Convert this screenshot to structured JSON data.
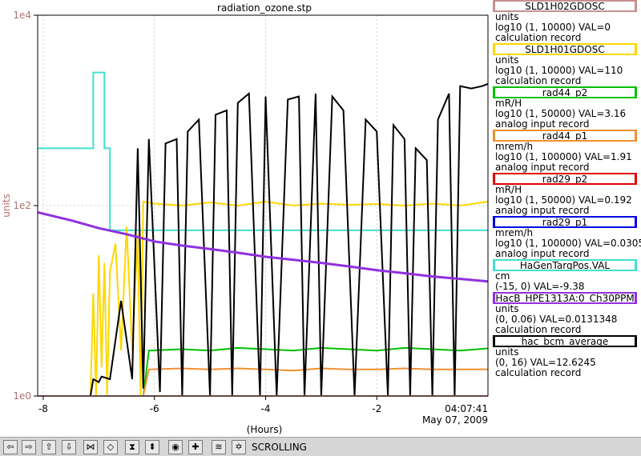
{
  "chart_data": {
    "type": "line",
    "title": "radiation_ozone.stp",
    "xlabel": "(Hours)",
    "ylabel": "units",
    "xlim": [
      -8.1,
      0
    ],
    "ylim": [
      1,
      10000
    ],
    "yscale": "log",
    "x_ticks": [
      "-8",
      "-6",
      "-4",
      "-2"
    ],
    "y_ticks": [
      "1e0",
      "1e2",
      "1e4"
    ],
    "end_time": "04:07:41",
    "end_date": "May 07, 2009",
    "grid": true,
    "series": [
      {
        "name": "SLD1H02GDOSC",
        "units": "units",
        "range": "log10 (1, 10000)  VAL=0",
        "record": "calculation record",
        "color": "#c89090",
        "x": [
          -8.1,
          0
        ],
        "y": [
          1,
          1
        ]
      },
      {
        "name": "SLD1H01GDOSC",
        "units": "units",
        "range": "log10 (1, 10000) VAL=110",
        "record": "calculation record",
        "color": "#ffd700",
        "x": [
          -8.1,
          -7.15,
          -7.1,
          -7.05,
          -7.0,
          -6.95,
          -6.9,
          -6.85,
          -6.8,
          -6.7,
          -6.6,
          -6.5,
          -6.4,
          -6.3,
          -6.25,
          -6.2,
          -6.0,
          -5.5,
          -5.0,
          -4.5,
          -4.0,
          -3.5,
          -3.0,
          -2.5,
          -2.0,
          -1.5,
          -1.0,
          -0.5,
          0
        ],
        "y": [
          1,
          1,
          12,
          1,
          30,
          2,
          25,
          1,
          20,
          40,
          3,
          60,
          3,
          50,
          1,
          110,
          105,
          100,
          108,
          100,
          110,
          100,
          105,
          102,
          104,
          100,
          105,
          100,
          110
        ]
      },
      {
        "name": "rad44_p2",
        "units": "mR/H",
        "range": "log10 (1, 50000) VAL=3.16",
        "record": "analog input record",
        "color": "#00c000",
        "x": [
          -8.1,
          -6.2,
          -6.1,
          -5.5,
          -5.0,
          -4.5,
          -4.0,
          -3.5,
          -3.0,
          -2.5,
          -2.0,
          -1.5,
          -1.0,
          -0.5,
          0
        ],
        "y": [
          1,
          1,
          3.0,
          3.1,
          3.0,
          3.2,
          3.1,
          3.0,
          3.2,
          3.1,
          3.0,
          3.2,
          3.1,
          3.0,
          3.16
        ]
      },
      {
        "name": "rad44_p1",
        "units": "mrem/h",
        "range": "log10 (1, 100000) VAL=1.91",
        "record": "analog input record",
        "color": "#f09030",
        "x": [
          -8.1,
          -6.2,
          -6.1,
          -5.5,
          -5.0,
          -4.5,
          -4.0,
          -3.5,
          -3.0,
          -2.5,
          -2.0,
          -1.5,
          -1.0,
          -0.5,
          0
        ],
        "y": [
          1,
          1,
          1.9,
          1.95,
          1.9,
          1.95,
          1.9,
          1.85,
          1.95,
          1.9,
          1.9,
          1.95,
          1.9,
          1.9,
          1.91
        ]
      },
      {
        "name": "rad29_p2",
        "units": "mR/H",
        "range": "log10 (1, 50000) VAL=0.192",
        "record": "analog input record",
        "color": "#e00000",
        "x": [],
        "y": []
      },
      {
        "name": "rad29_p1",
        "units": "mrem/h",
        "range": "log10 (1, 100000) VAL=0.0305",
        "record": "analog input record",
        "color": "#0000e0",
        "x": [],
        "y": []
      },
      {
        "name": "HaGenTargPos.VAL",
        "units": "cm",
        "range": "(-15, 0) VAL=-9.38",
        "record": "",
        "color": "#40e0d0",
        "x": [
          -8.1,
          -7.1,
          -7.1,
          -6.9,
          -6.9,
          -6.8,
          -6.8,
          0
        ],
        "y": [
          400,
          400,
          2500,
          2500,
          400,
          400,
          55,
          55
        ]
      },
      {
        "name": "HacB_HPE1313A:0_Ch30PPM",
        "units": "units",
        "range": "(0, 0.06) VAL=0.0131348",
        "record": "calculation record",
        "color": "#9030e0",
        "x": [
          -8.1,
          -7.5,
          -7.0,
          -6.5,
          -6.0,
          -5.5,
          -5.0,
          -4.5,
          -4.0,
          -3.5,
          -3.0,
          -2.5,
          -2.0,
          -1.5,
          -1.0,
          -0.5,
          0
        ],
        "y": [
          85,
          70,
          58,
          50,
          42,
          38,
          35,
          32,
          29,
          27,
          25,
          23,
          21,
          19.5,
          18,
          17,
          16
        ]
      },
      {
        "name": "hac_bcm_average",
        "units": "units",
        "range": "(0, 16) VAL=12.6245",
        "record": "calculation record",
        "color": "#000000",
        "x": [
          -8.1,
          -7.15,
          -7.1,
          -7.0,
          -6.95,
          -6.8,
          -6.6,
          -6.4,
          -6.3,
          -6.2,
          -6.1,
          -5.9,
          -5.8,
          -5.6,
          -5.5,
          -5.4,
          -5.2,
          -5.0,
          -4.9,
          -4.7,
          -4.6,
          -4.5,
          -4.3,
          -4.1,
          -4.0,
          -3.8,
          -3.6,
          -3.4,
          -3.3,
          -3.1,
          -3.0,
          -2.8,
          -2.6,
          -2.4,
          -2.2,
          -2.0,
          -1.8,
          -1.7,
          -1.5,
          -1.4,
          -1.3,
          -1.1,
          -1.0,
          -0.9,
          -0.7,
          -0.6,
          -0.5,
          -0.3,
          -0.1,
          0
        ],
        "y": [
          1,
          1,
          1.5,
          1.4,
          1.6,
          1.5,
          10,
          1.5,
          400,
          1.2,
          500,
          1.1,
          450,
          500,
          1.0,
          600,
          800,
          1.0,
          900,
          1000,
          1.0,
          1200,
          1500,
          1.0,
          1400,
          1.0,
          1300,
          1400,
          1.0,
          1500,
          1.0,
          1400,
          1000,
          1.0,
          800,
          600,
          1.0,
          700,
          500,
          1.0,
          400,
          300,
          1.0,
          800,
          1500,
          1.0,
          1800,
          1700,
          1800,
          1900
        ]
      }
    ]
  },
  "toolbar": {
    "buttons": [
      {
        "name": "scroll-left-button",
        "glyph": "⇦"
      },
      {
        "name": "scroll-right-button",
        "glyph": "⇨"
      },
      {
        "name": "scroll-up-button",
        "glyph": "⇧"
      },
      {
        "name": "scroll-down-button",
        "glyph": "⇩"
      },
      {
        "name": "zoom-in-x-button",
        "glyph": "⋈"
      },
      {
        "name": "zoom-out-x-button",
        "glyph": "◇"
      },
      {
        "name": "zoom-in-y-button",
        "glyph": "⧗"
      },
      {
        "name": "zoom-out-y-button",
        "glyph": "⬍"
      },
      {
        "name": "auto-scale-button",
        "glyph": "◉"
      },
      {
        "name": "add-button",
        "glyph": "✚"
      },
      {
        "name": "mode-button",
        "glyph": "≋"
      },
      {
        "name": "scroll-mode-button",
        "glyph": "✡"
      }
    ],
    "status": "SCROLLING"
  }
}
